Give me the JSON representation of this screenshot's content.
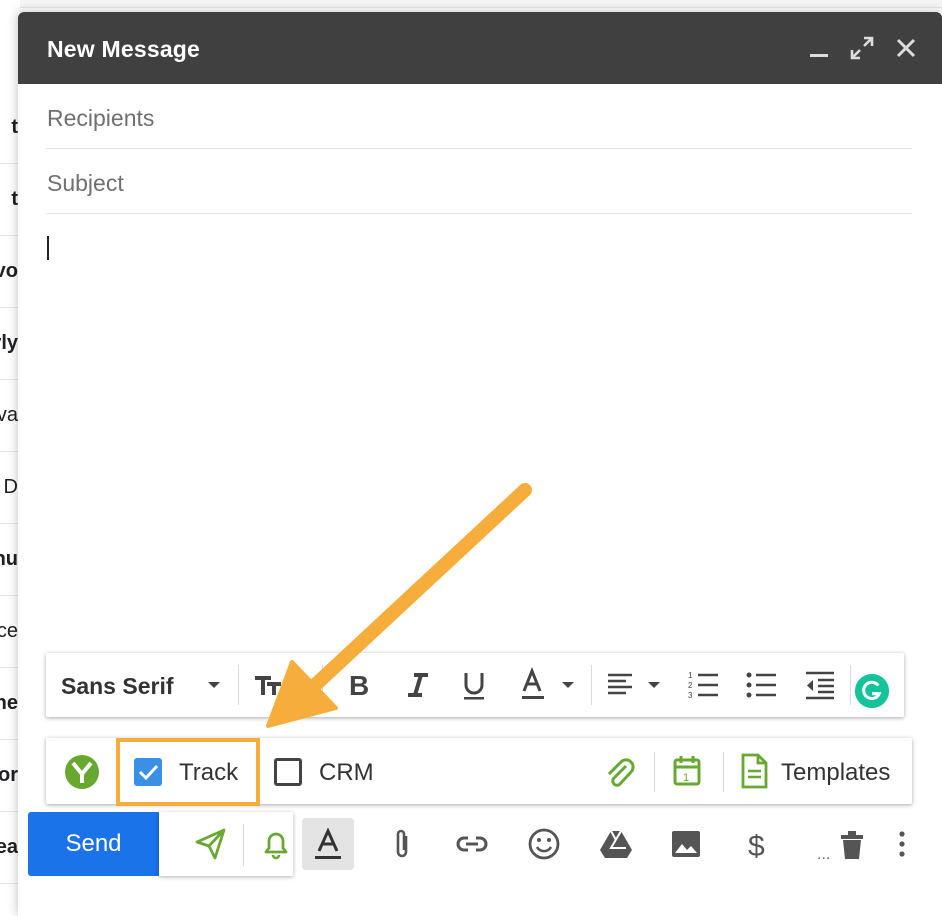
{
  "background_list": {
    "rows": [
      {
        "text": "t",
        "bold": true
      },
      {
        "text": "t",
        "bold": true
      },
      {
        "text": "vo",
        "bold": true
      },
      {
        "text": "rly",
        "bold": true
      },
      {
        "text": "va",
        "bold": false
      },
      {
        "text": "D",
        "bold": false
      },
      {
        "text": "hu",
        "bold": true
      },
      {
        "text": "ce",
        "bold": false
      },
      {
        "text": "ne",
        "bold": true
      },
      {
        "text": "or",
        "bold": true
      },
      {
        "text": "ea",
        "bold": true
      }
    ]
  },
  "compose": {
    "title": "New Message",
    "recipients_placeholder": "Recipients",
    "subject_placeholder": "Subject",
    "body": ""
  },
  "format_toolbar": {
    "font": "Sans Serif"
  },
  "extension_toolbar": {
    "track_label": "Track",
    "track_checked": true,
    "crm_label": "CRM",
    "crm_checked": false,
    "templates_label": "Templates"
  },
  "bottom_bar": {
    "send_label": "Send",
    "more_label": "..."
  },
  "colors": {
    "header_bg": "#404040",
    "send_blue": "#1a73e8",
    "checkbox_blue": "#3b8fe4",
    "extension_green": "#67a831",
    "highlight_orange": "#f6ad3c",
    "grammarly_green": "#15c39a"
  },
  "icons": [
    "minimize-icon",
    "expand-icon",
    "close-icon",
    "text-size-icon",
    "bold-icon",
    "italic-icon",
    "underline-icon",
    "text-color-icon",
    "align-icon",
    "numbered-list-icon",
    "bulleted-list-icon",
    "indent-less-icon",
    "grammarly-icon",
    "yesware-logo-icon",
    "paperclip-icon",
    "calendar-icon",
    "document-icon",
    "send-later-icon",
    "bell-icon",
    "formatting-icon",
    "attach-icon",
    "link-icon",
    "emoji-icon",
    "drive-icon",
    "photo-icon",
    "dollar-icon",
    "trash-icon",
    "more-vert-icon"
  ]
}
